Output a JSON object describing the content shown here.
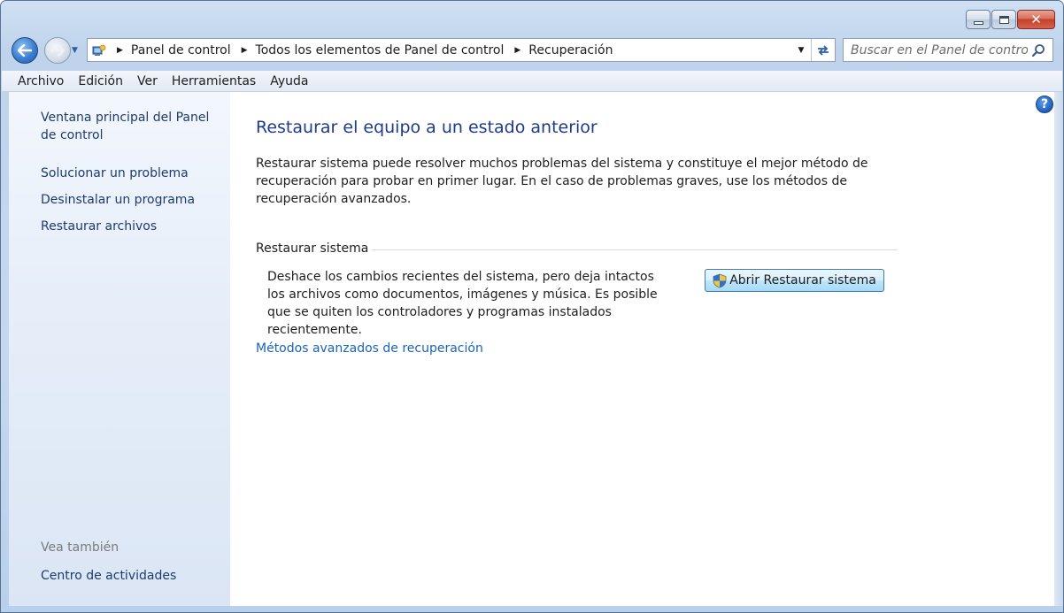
{
  "window": {
    "caption_buttons": {
      "minimize": "minimize",
      "maximize": "maximize",
      "close": "✕"
    }
  },
  "nav": {
    "breadcrumbs": [
      "Panel de control",
      "Todos los elementos de Panel de control",
      "Recuperación"
    ],
    "search_placeholder": "Buscar en el Panel de control"
  },
  "menu": [
    "Archivo",
    "Edición",
    "Ver",
    "Herramientas",
    "Ayuda"
  ],
  "sidebar": {
    "home_link": "Ventana principal del Panel de control",
    "links": [
      "Solucionar un problema",
      "Desinstalar un programa",
      "Restaurar archivos"
    ],
    "see_also_label": "Vea también",
    "see_also_links": [
      "Centro de actividades"
    ]
  },
  "main": {
    "title": "Restaurar el equipo a un estado anterior",
    "intro": "Restaurar sistema puede resolver muchos problemas del sistema y constituye el mejor método de recuperación para probar en primer lugar. En el caso de problemas graves, use los métodos de recuperación avanzados.",
    "group_title": "Restaurar sistema",
    "group_description": "Deshace los cambios recientes del sistema, pero deja intactos los archivos como documentos, imágenes y música. Es posible que se quiten los controladores y programas instalados recientemente.",
    "open_button": "Abrir Restaurar sistema",
    "advanced_link": "Métodos avanzados de recuperación",
    "help_glyph": "?"
  },
  "colors": {
    "title_blue": "#1e3a8a",
    "link_blue": "#1a63b8",
    "sidebar_link": "#1e3a6e",
    "muted": "#7a7a7a"
  },
  "icons": {
    "back": "back-arrow-icon",
    "forward": "forward-arrow-icon",
    "root": "control-panel-icon",
    "refresh": "refresh-icon",
    "search": "search-icon",
    "help": "help-icon",
    "shield": "uac-shield-icon"
  }
}
